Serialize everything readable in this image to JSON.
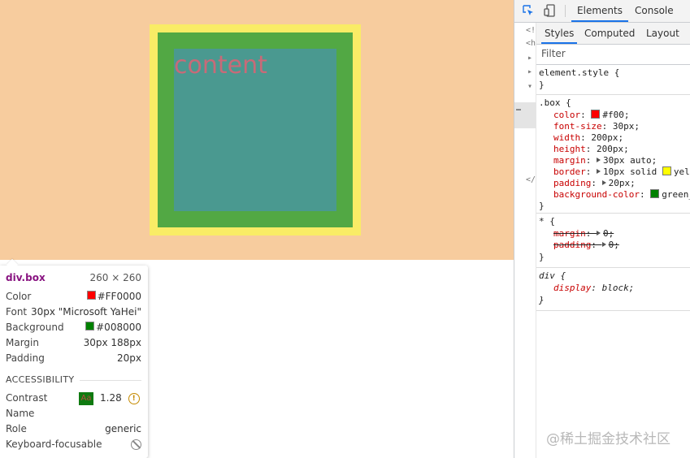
{
  "viewport": {
    "page_background": "#f7cc9e",
    "box": {
      "text": "content",
      "text_color": "#ff0000",
      "margin_color": "#f9ec66",
      "border_color": "#52a844",
      "content_color": "#4a9990"
    }
  },
  "tooltip": {
    "selector": "div.box",
    "size": "260 × 260",
    "rows": [
      {
        "key": "Color",
        "value": "#FF0000",
        "swatch": "#ff0000"
      },
      {
        "key": "Font",
        "value": "30px \"Microsoft YaHei\""
      },
      {
        "key": "Background",
        "value": "#008000",
        "swatch": "#008000"
      },
      {
        "key": "Margin",
        "value": "30px 188px"
      },
      {
        "key": "Padding",
        "value": "20px"
      }
    ],
    "accessibility": {
      "heading": "ACCESSIBILITY",
      "contrast_label": "Contrast",
      "contrast_sample": "Aa",
      "contrast_value": "1.28",
      "contrast_icon": "warning-icon",
      "name_label": "Name",
      "name_value": "",
      "role_label": "Role",
      "role_value": "generic",
      "keyboard_label": "Keyboard-focusable",
      "keyboard_icon": "not-allowed-icon"
    }
  },
  "devtools": {
    "toolbar": {
      "inspect_icon": "inspect-element-icon",
      "device_icon": "device-toggle-icon",
      "tabs": [
        "Elements",
        "Console"
      ]
    },
    "dom_gutter": [
      "<!",
      "<h",
      "▸",
      "▸",
      "▾",
      "…",
      "</"
    ],
    "styles": {
      "tabs": [
        "Styles",
        "Computed",
        "Layout"
      ],
      "filter_placeholder": "Filter",
      "rules": {
        "element_style": {
          "selector": "element.style {",
          "close": "}"
        },
        "box": {
          "selector": ".box {",
          "close": "}",
          "props": [
            {
              "name": "color",
              "value": "#f00;",
              "swatch": "#ff0000"
            },
            {
              "name": "font-size",
              "value": "30px;"
            },
            {
              "name": "width",
              "value": "200px;"
            },
            {
              "name": "height",
              "value": "200px;"
            },
            {
              "name": "margin",
              "value": "30px auto;",
              "expand": true
            },
            {
              "name": "border",
              "value": "10px solid",
              "tail": "yell",
              "swatch": "#ffff00",
              "expand": true
            },
            {
              "name": "padding",
              "value": "20px;",
              "expand": true
            },
            {
              "name": "background-color",
              "value": "green_",
              "swatch": "#008000",
              "swatch_first": true
            }
          ]
        },
        "universal": {
          "selector": "* {",
          "close": "}",
          "props": [
            {
              "name": "margin",
              "value": "0;"
            },
            {
              "name": "padding",
              "value": "0;"
            }
          ]
        },
        "div": {
          "selector": "div {",
          "close": "}",
          "props": [
            {
              "name": "display",
              "value": "block;"
            }
          ]
        }
      }
    }
  },
  "watermark": "@稀土掘金技术社区"
}
